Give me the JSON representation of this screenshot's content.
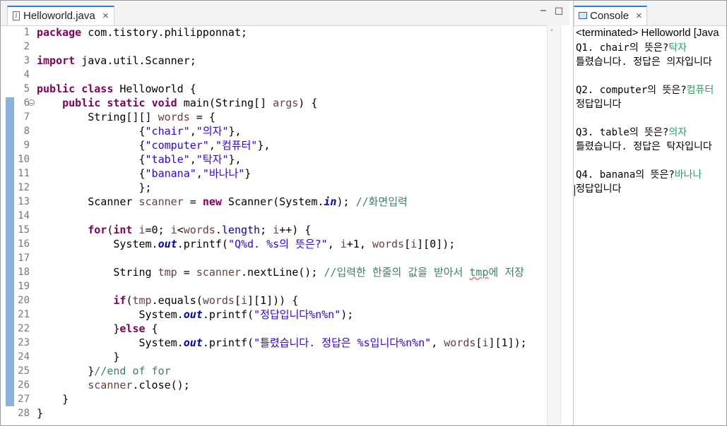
{
  "editor": {
    "tab_title": "Helloworld.java",
    "tab_close": "×",
    "minimize": "−",
    "maximize": "□",
    "scroll_up": "˄",
    "lines": [
      [
        {
          "t": "package",
          "c": "kw"
        },
        {
          "t": " com.tistory.philipponnat;"
        }
      ],
      [],
      [
        {
          "t": "import",
          "c": "kw"
        },
        {
          "t": " java.util.Scanner;"
        }
      ],
      [],
      [
        {
          "t": "public",
          "c": "kw"
        },
        {
          "t": " "
        },
        {
          "t": "class",
          "c": "kw"
        },
        {
          "t": " Helloworld {"
        }
      ],
      [
        {
          "t": "    "
        },
        {
          "t": "public",
          "c": "kw"
        },
        {
          "t": " "
        },
        {
          "t": "static",
          "c": "kw"
        },
        {
          "t": " "
        },
        {
          "t": "void",
          "c": "kw"
        },
        {
          "t": " main(String[] "
        },
        {
          "t": "args",
          "c": "loc"
        },
        {
          "t": ") {"
        }
      ],
      [
        {
          "t": "        String[][] "
        },
        {
          "t": "words",
          "c": "loc"
        },
        {
          "t": " = {"
        }
      ],
      [
        {
          "t": "                {"
        },
        {
          "t": "\"chair\"",
          "c": "str"
        },
        {
          "t": ","
        },
        {
          "t": "\"의자\"",
          "c": "str"
        },
        {
          "t": "},"
        }
      ],
      [
        {
          "t": "                {"
        },
        {
          "t": "\"computer\"",
          "c": "str"
        },
        {
          "t": ","
        },
        {
          "t": "\"컴퓨터\"",
          "c": "str"
        },
        {
          "t": "},"
        }
      ],
      [
        {
          "t": "                {"
        },
        {
          "t": "\"table\"",
          "c": "str"
        },
        {
          "t": ","
        },
        {
          "t": "\"탁자\"",
          "c": "str"
        },
        {
          "t": "},"
        }
      ],
      [
        {
          "t": "                {"
        },
        {
          "t": "\"banana\"",
          "c": "str"
        },
        {
          "t": ","
        },
        {
          "t": "\"바나나\"",
          "c": "str"
        },
        {
          "t": "}"
        }
      ],
      [
        {
          "t": "                };"
        }
      ],
      [
        {
          "t": "        Scanner "
        },
        {
          "t": "scanner",
          "c": "loc"
        },
        {
          "t": " = "
        },
        {
          "t": "new",
          "c": "kw"
        },
        {
          "t": " Scanner(System."
        },
        {
          "t": "in",
          "c": "sfld"
        },
        {
          "t": "); "
        },
        {
          "t": "//화면입력",
          "c": "cmt"
        }
      ],
      [],
      [
        {
          "t": "        "
        },
        {
          "t": "for",
          "c": "kw"
        },
        {
          "t": "("
        },
        {
          "t": "int",
          "c": "kw"
        },
        {
          "t": " "
        },
        {
          "t": "i",
          "c": "loc"
        },
        {
          "t": "=0; "
        },
        {
          "t": "i",
          "c": "loc"
        },
        {
          "t": "<"
        },
        {
          "t": "words",
          "c": "loc"
        },
        {
          "t": "."
        },
        {
          "t": "length",
          "c": "fld"
        },
        {
          "t": "; "
        },
        {
          "t": "i",
          "c": "loc"
        },
        {
          "t": "++) {"
        }
      ],
      [
        {
          "t": "            System."
        },
        {
          "t": "out",
          "c": "sfld"
        },
        {
          "t": ".printf("
        },
        {
          "t": "\"Q%d. %s의 뜻은?\"",
          "c": "str"
        },
        {
          "t": ", "
        },
        {
          "t": "i",
          "c": "loc"
        },
        {
          "t": "+1, "
        },
        {
          "t": "words",
          "c": "loc"
        },
        {
          "t": "["
        },
        {
          "t": "i",
          "c": "loc"
        },
        {
          "t": "][0]);"
        }
      ],
      [],
      [
        {
          "t": "            String "
        },
        {
          "t": "tmp",
          "c": "loc"
        },
        {
          "t": " = "
        },
        {
          "t": "scanner",
          "c": "loc"
        },
        {
          "t": ".nextLine(); "
        },
        {
          "t": "//입력한 한줄의 값을 받아서 ",
          "c": "cmt"
        },
        {
          "t": "tmp",
          "c": "cmt sq"
        },
        {
          "t": "에 저장",
          "c": "cmt"
        }
      ],
      [],
      [
        {
          "t": "            "
        },
        {
          "t": "if",
          "c": "kw"
        },
        {
          "t": "("
        },
        {
          "t": "tmp",
          "c": "loc"
        },
        {
          "t": ".equals("
        },
        {
          "t": "words",
          "c": "loc"
        },
        {
          "t": "["
        },
        {
          "t": "i",
          "c": "loc"
        },
        {
          "t": "][1])) {"
        }
      ],
      [
        {
          "t": "                System."
        },
        {
          "t": "out",
          "c": "sfld"
        },
        {
          "t": ".printf("
        },
        {
          "t": "\"정답입니다%n%n\"",
          "c": "str"
        },
        {
          "t": ");"
        }
      ],
      [
        {
          "t": "            }"
        },
        {
          "t": "else",
          "c": "kw"
        },
        {
          "t": " {"
        }
      ],
      [
        {
          "t": "                System."
        },
        {
          "t": "out",
          "c": "sfld"
        },
        {
          "t": ".printf("
        },
        {
          "t": "\"틀렸습니다. 정답은 %s입니다%n%n\"",
          "c": "str"
        },
        {
          "t": ", "
        },
        {
          "t": "words",
          "c": "loc"
        },
        {
          "t": "["
        },
        {
          "t": "i",
          "c": "loc"
        },
        {
          "t": "][1]);"
        }
      ],
      [
        {
          "t": "            }"
        }
      ],
      [
        {
          "t": "        }"
        },
        {
          "t": "//end of for",
          "c": "cmt"
        }
      ],
      [
        {
          "t": "        "
        },
        {
          "t": "scanner",
          "c": "loc"
        },
        {
          "t": ".close();"
        }
      ],
      [
        {
          "t": "    }"
        }
      ],
      [
        {
          "t": "}"
        }
      ]
    ]
  },
  "console": {
    "tab_title": "Console",
    "tab_close": "×",
    "header": "<terminated> Helloworld [Java",
    "lines": [
      [
        {
          "t": "Q1. chair의 뜻은?"
        },
        {
          "t": "탁자",
          "c": "inp"
        }
      ],
      [
        {
          "t": "틀렸습니다. 정답은 의자입니다"
        }
      ],
      [],
      [
        {
          "t": "Q2. computer의 뜻은?"
        },
        {
          "t": "컴퓨터",
          "c": "inp"
        }
      ],
      [
        {
          "t": "정답입니다"
        }
      ],
      [],
      [
        {
          "t": "Q3. table의 뜻은?"
        },
        {
          "t": "의자",
          "c": "inp"
        }
      ],
      [
        {
          "t": "틀렸습니다. 정답은 탁자입니다"
        }
      ],
      [],
      [
        {
          "t": "Q4. banana의 뜻은?"
        },
        {
          "t": "바나나",
          "c": "inp"
        }
      ],
      [
        {
          "t": "정답입니다"
        }
      ]
    ]
  }
}
